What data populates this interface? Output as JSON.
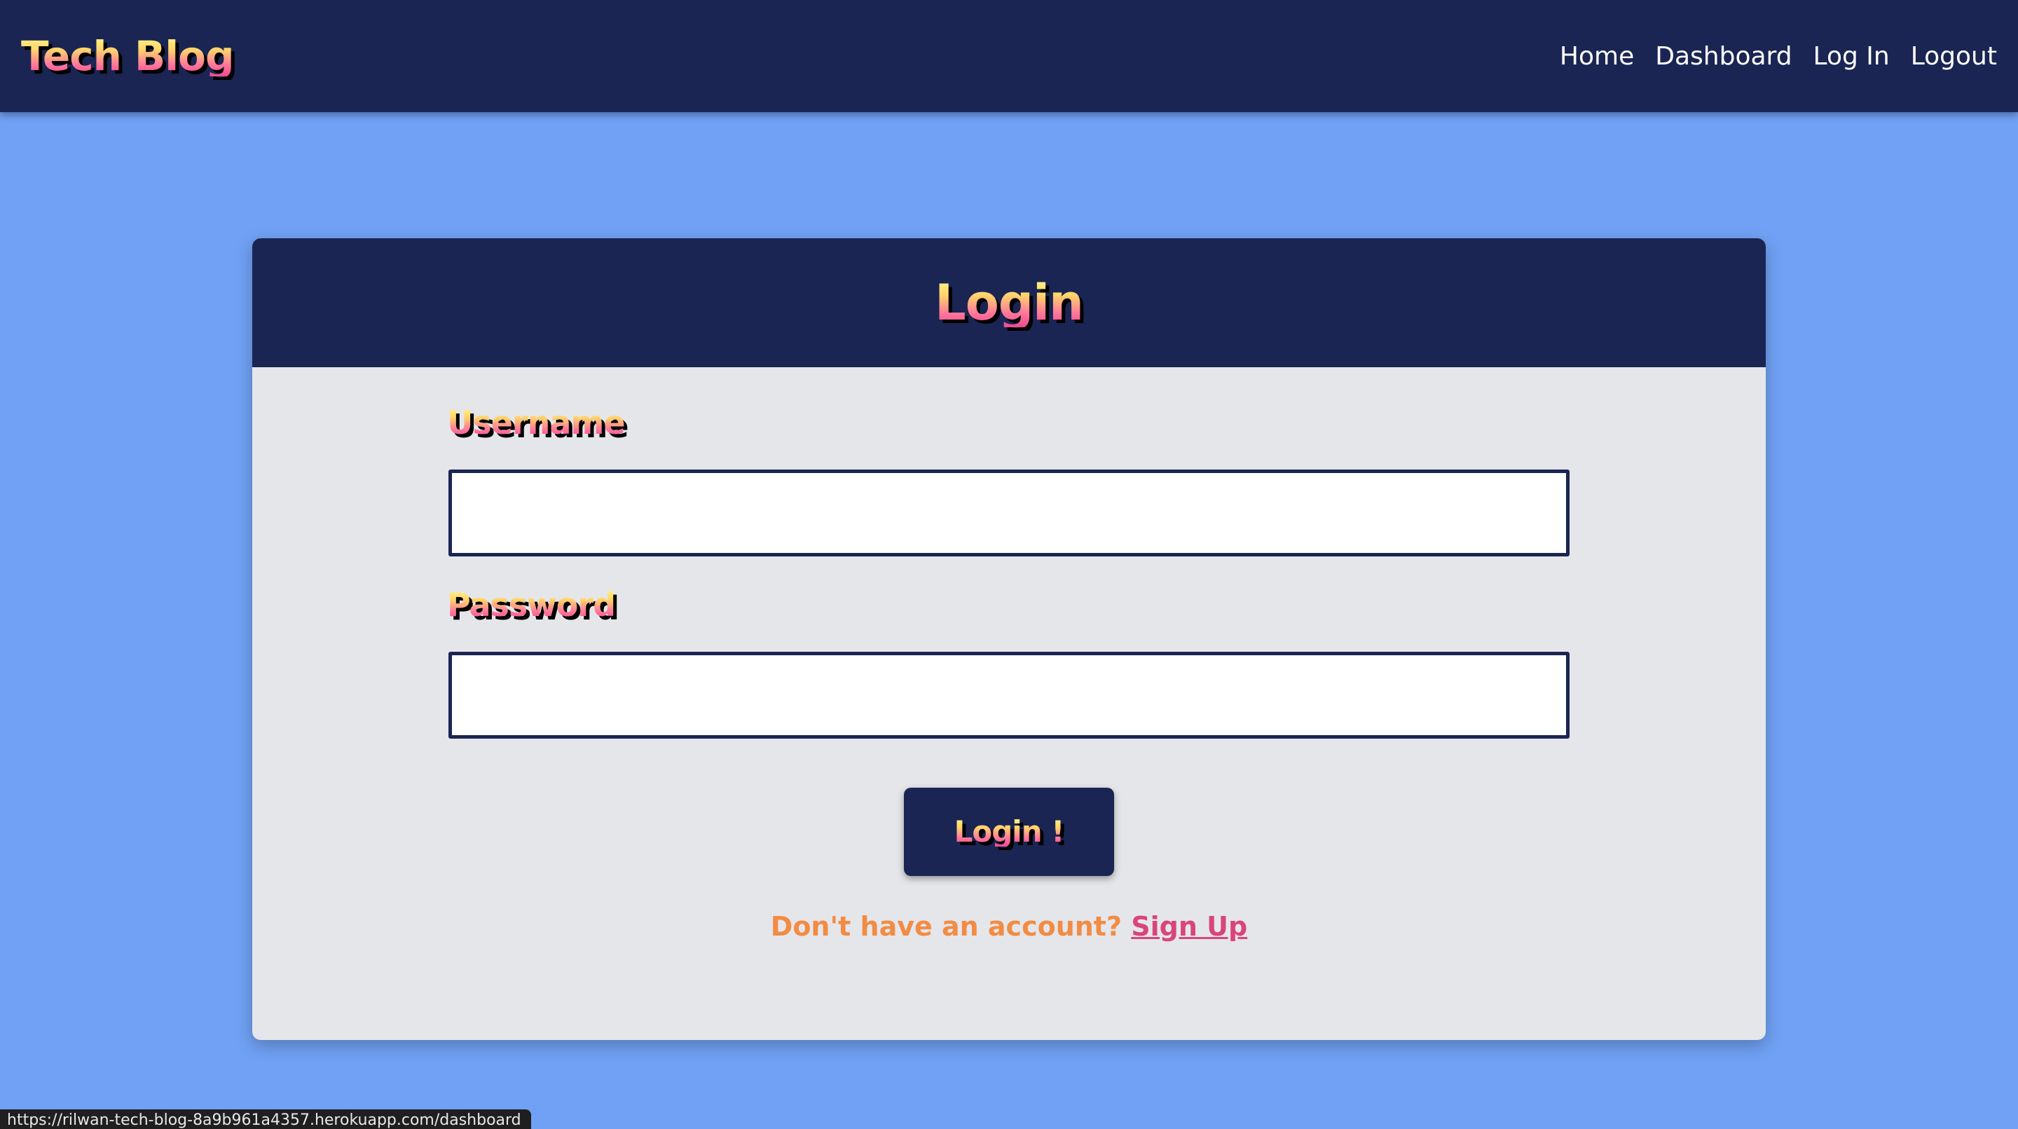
{
  "navbar": {
    "brand": "Tech Blog",
    "links": [
      "Home",
      "Dashboard",
      "Log In",
      "Logout"
    ]
  },
  "login_card": {
    "title": "Login",
    "username_label": "Username",
    "username_value": "",
    "password_label": "Password",
    "password_value": "",
    "submit_label": "Login !",
    "signup_prompt": "Don't have an account?",
    "signup_link": "Sign Up"
  },
  "status_bar": {
    "url": "https://rilwan-tech-blog-8a9b961a4357.herokuapp.com/dashboard"
  },
  "colors": {
    "page_background": "#70a1f4",
    "navbar_background": "#1b2553",
    "card_background": "#e5e6ea",
    "prompt_text": "#f28c44",
    "signup_link": "#d9457a"
  }
}
